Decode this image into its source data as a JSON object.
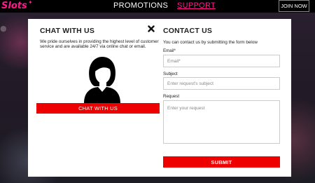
{
  "header": {
    "logo": "Slots",
    "nav": [
      {
        "label": "PROMOTIONS"
      },
      {
        "label": "SUPPORT"
      }
    ],
    "join_label": "JOIN NOW"
  },
  "chat": {
    "title": "CHAT WITH US",
    "description": "We pride ourselves in providing the highest level of customer service and are available 24/7 via online chat or email.",
    "button_label": "CHAT WITH US"
  },
  "contact": {
    "title": "CONTACT US",
    "description": "You can contact us by submitting the form below",
    "email_label": "Email*",
    "email_placeholder": "Email*",
    "subject_label": "Subject",
    "subject_placeholder": "Enter request's subject",
    "request_label": "Request",
    "request_placeholder": "Enter your request",
    "submit_label": "SUBMIT"
  },
  "colors": {
    "accent": "#ee0000",
    "brand": "#ff1a8c"
  }
}
